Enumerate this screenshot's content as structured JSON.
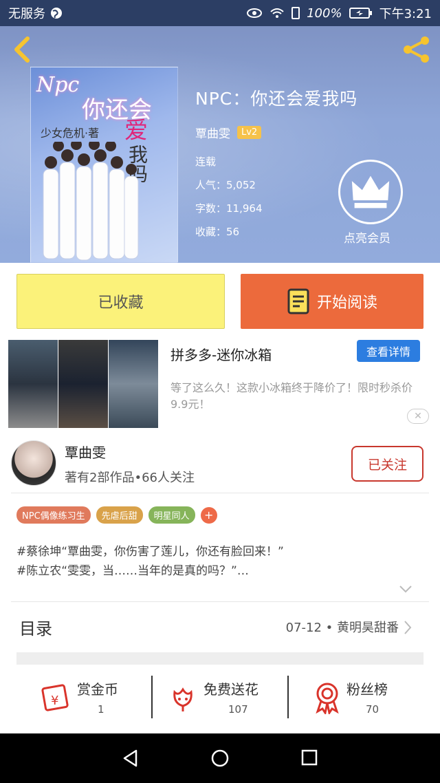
{
  "status_bar": {
    "carrier": "无服务",
    "battery": "100%",
    "time": "下午3:21"
  },
  "book": {
    "title": "NPC：你还会爱我吗",
    "author": "覃曲雯",
    "level": "Lv2",
    "status": "连载",
    "popularity": "人气：5,052",
    "word_count": "字数：11,964",
    "favorites": "收藏：56",
    "cover_text": {
      "latin": "Npc",
      "line1": "你还会",
      "line2": "少女危机·著",
      "accent": "爱",
      "line3": "我吗"
    }
  },
  "vip": {
    "label": "点亮会员"
  },
  "actions": {
    "favorited_label": "已收藏",
    "read_label": "开始阅读"
  },
  "ad": {
    "title": "拼多多-迷你冰箱",
    "button": "查看详情",
    "description": "等了这么久！这款小冰箱终于降价了！限时秒杀价9.9元！",
    "close": "✕"
  },
  "author_card": {
    "name": "覃曲雯",
    "stats": "著有2部作品•66人关注",
    "follow_label": "已关注"
  },
  "tags": [
    {
      "label": "NPC偶像练习生",
      "color": "#e07a5c"
    },
    {
      "label": "先虐后甜",
      "color": "#d9a24a"
    },
    {
      "label": "明星同人",
      "color": "#86b45a"
    }
  ],
  "tag_add": "+",
  "intro": "#蔡徐坤“覃曲雯，你伤害了莲儿，你还有脸回来！”\n#陈立农“雯雯，当……当年的是真的吗？”…",
  "toc": {
    "label": "目录",
    "latest": "07-12 • 黄明昊甜番"
  },
  "bottom_actions": [
    {
      "label": "赏金币",
      "count": "1"
    },
    {
      "label": "免费送花",
      "count": "107"
    },
    {
      "label": "粉丝榜",
      "count": "70"
    }
  ],
  "colors": {
    "hero": "#8ea6d8",
    "read_button": "#ec6a3c",
    "favorited_button": "#fbf27a",
    "follow": "#c8372d",
    "icon_red": "#d9342b"
  }
}
